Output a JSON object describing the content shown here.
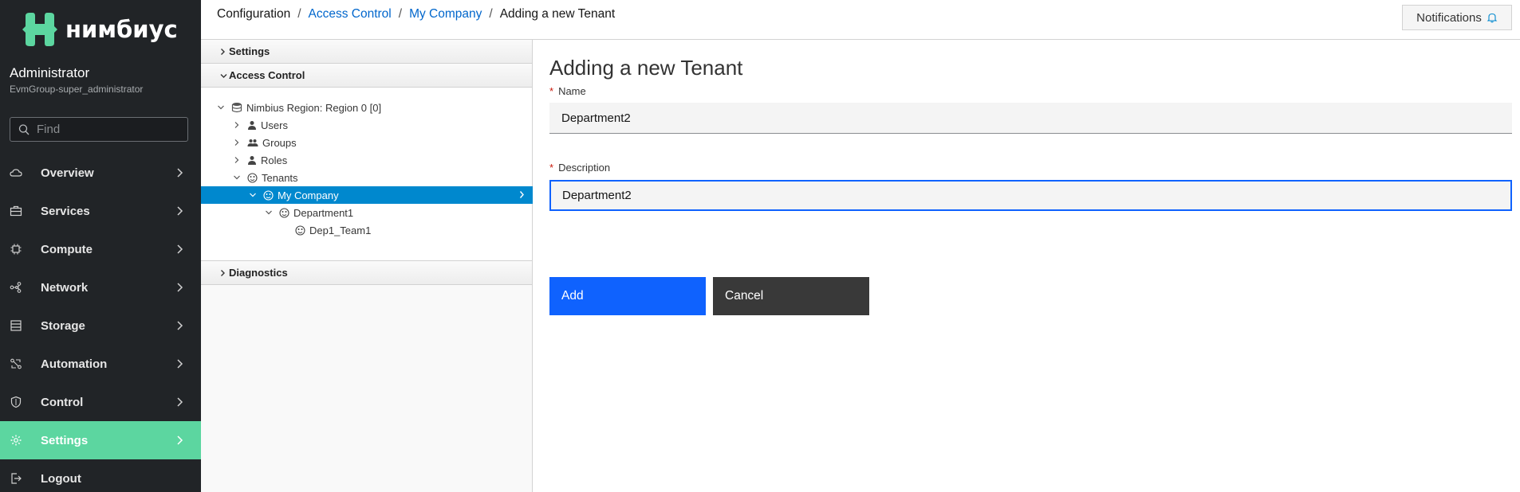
{
  "brand": {
    "name": "нимбиус",
    "color": "#5cd6a0"
  },
  "user": {
    "name": "Administrator",
    "group": "EvmGroup-super_administrator"
  },
  "search": {
    "placeholder": "Find"
  },
  "nav": {
    "items": [
      {
        "label": "Overview",
        "icon": "cloud-icon"
      },
      {
        "label": "Services",
        "icon": "briefcase-icon"
      },
      {
        "label": "Compute",
        "icon": "cpu-icon"
      },
      {
        "label": "Network",
        "icon": "network-icon"
      },
      {
        "label": "Storage",
        "icon": "database-icon"
      },
      {
        "label": "Automation",
        "icon": "automation-icon"
      },
      {
        "label": "Control",
        "icon": "shield-icon"
      },
      {
        "label": "Settings",
        "icon": "gear-icon",
        "active": true
      },
      {
        "label": "Logout",
        "icon": "logout-icon"
      }
    ]
  },
  "breadcrumb": {
    "root": "Configuration",
    "level1": "Access Control",
    "level2": "My Company",
    "current": "Adding a new Tenant",
    "separator": "/"
  },
  "header": {
    "notifications_label": "Notifications"
  },
  "accordion": {
    "settings": "Settings",
    "access_control": "Access Control",
    "diagnostics": "Diagnostics",
    "tree": {
      "region": "Nimbius Region: Region 0 [0]",
      "users": "Users",
      "groups": "Groups",
      "roles": "Roles",
      "tenants": "Tenants",
      "my_company": "My Company",
      "department1": "Department1",
      "dep1_team1": "Dep1_Team1"
    }
  },
  "form": {
    "title": "Adding a new Tenant",
    "required_mark": "*",
    "name_label": "Name",
    "name_value": "Department2",
    "description_label": "Description",
    "description_value": "Department2",
    "add_label": "Add",
    "cancel_label": "Cancel"
  },
  "colors": {
    "sidebar_bg": "#212427",
    "active_nav": "#5cd6a0",
    "tree_selected": "#0088ce",
    "primary_button": "#0f62fe",
    "secondary_button": "#393939",
    "link": "#0066cc"
  }
}
